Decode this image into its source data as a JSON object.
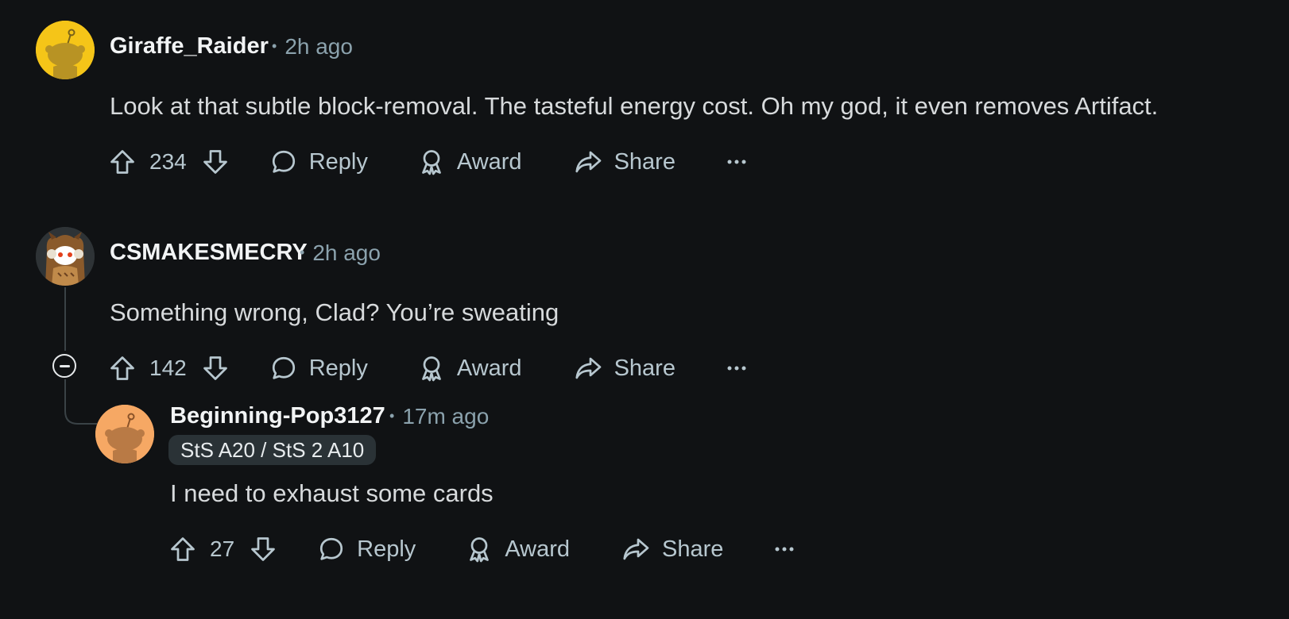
{
  "comments": [
    {
      "username": "Giraffe_Raider",
      "time": "2h ago",
      "body": "Look at that subtle block-removal. The tasteful energy cost. Oh my god, it even removes Artifact.",
      "votes": "234",
      "avatar_color": "#f5c518",
      "avatar_icon": "snoo-avatar-icon"
    },
    {
      "username": "CSMAKESMECRY",
      "time": "2h ago",
      "body": "Something wrong, Clad? You’re sweating",
      "votes": "142",
      "avatar_color": "#2e3336",
      "avatar_icon": "snoo-owl-costume-avatar-icon"
    },
    {
      "username": "Beginning-Pop3127",
      "time": "17m ago",
      "flair": "StS A20 / StS 2 A10",
      "body": "I need to exhaust some cards",
      "votes": "27",
      "avatar_color": "#f6a864",
      "avatar_icon": "snoo-avatar-icon"
    }
  ],
  "actions": {
    "reply": "Reply",
    "award": "Award",
    "share": "Share"
  },
  "colors": {
    "background": "#101214",
    "text": "#d7dadc",
    "muted": "#8ba2ad",
    "username": "#f2f4f5"
  }
}
